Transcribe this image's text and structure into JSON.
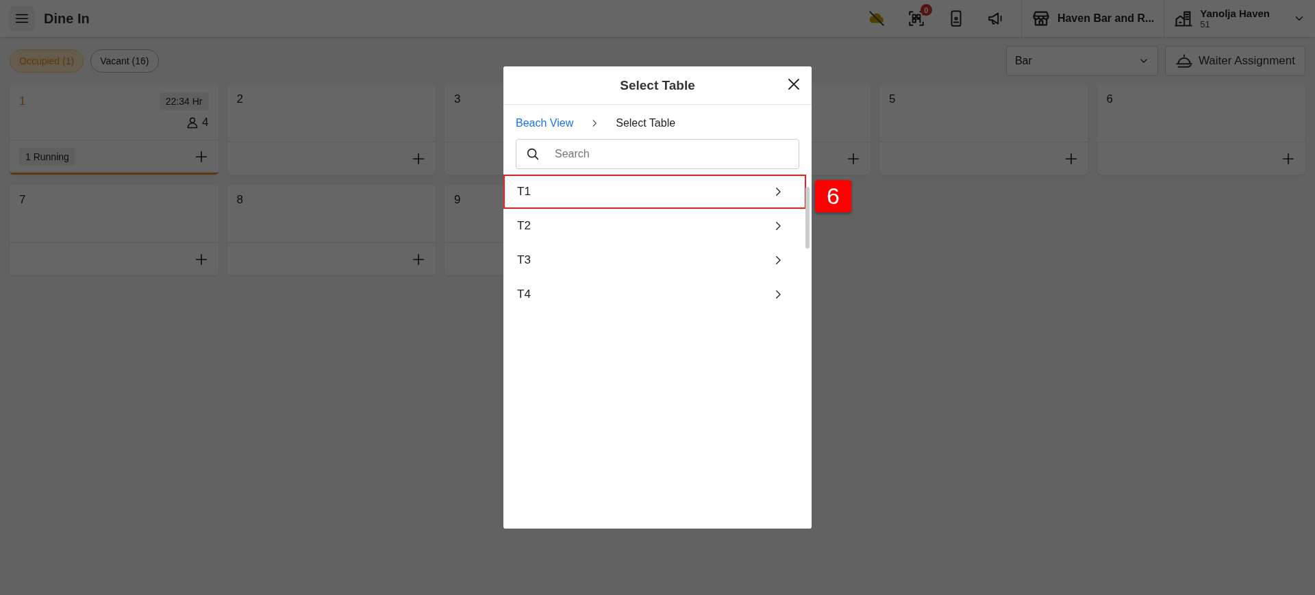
{
  "header": {
    "title": "Dine In",
    "qr_badge": "0",
    "outlet": "Haven Bar and R...",
    "property": {
      "name": "Yanolja Haven",
      "code": "51"
    }
  },
  "filters": [
    {
      "label": "Occupied (1)",
      "selected": true
    },
    {
      "label": "Vacant (16)",
      "selected": false
    }
  ],
  "area_select": {
    "value": "Bar"
  },
  "waiter_button": "Waiter Assignment",
  "tables": [
    {
      "number": "1",
      "occupied": true,
      "time": "22:34 Hr",
      "guests": "4",
      "status": "1 Running",
      "add_visible": true
    },
    {
      "number": "2",
      "occupied": false,
      "add_visible": true
    },
    {
      "number": "3",
      "occupied": false
    },
    {
      "occupied": false,
      "add_visible": true
    },
    {
      "number": "5",
      "occupied": false,
      "add_visible": true
    },
    {
      "number": "6",
      "occupied": false,
      "add_visible": true
    },
    {
      "number": "7",
      "occupied": false,
      "add_visible": true
    },
    {
      "number": "8",
      "occupied": false,
      "add_visible": true
    },
    {
      "number": "9",
      "occupied": false
    }
  ],
  "dialog": {
    "title": "Select Table",
    "breadcrumb": [
      "Beach View",
      "Select Table"
    ],
    "search": {
      "placeholder": "Search"
    },
    "items": [
      {
        "label": "T1",
        "highlighted": true
      },
      {
        "label": "T2",
        "highlighted": false
      },
      {
        "label": "T3",
        "highlighted": false
      },
      {
        "label": "T4",
        "highlighted": false
      }
    ]
  },
  "annotation": {
    "label": "6"
  }
}
